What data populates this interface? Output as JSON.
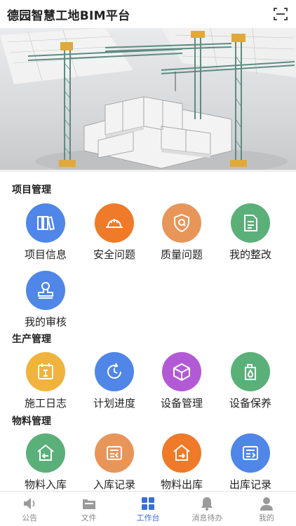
{
  "header": {
    "title": "德园智慧工地BIM平台",
    "scan_icon": "scan-icon"
  },
  "colors": {
    "accent": "#3a6ed6",
    "blue": "#4f86e8",
    "orange": "#ee7a2a",
    "light_orange": "#e8955a",
    "green": "#5bb07a",
    "yellow": "#f0b33e",
    "purple": "#b25ad6"
  },
  "sections": [
    {
      "title": "项目管理",
      "items": [
        {
          "label": "项目信息",
          "icon": "books-icon"
        },
        {
          "label": "安全问题",
          "icon": "hardhat-icon"
        },
        {
          "label": "质量问题",
          "icon": "shield-icon"
        },
        {
          "label": "我的整改",
          "icon": "document-icon"
        },
        {
          "label": "我的审核",
          "icon": "stamp-icon"
        }
      ]
    },
    {
      "title": "生产管理",
      "items": [
        {
          "label": "施工日志",
          "icon": "calendar-icon"
        },
        {
          "label": "计划进度",
          "icon": "clock-refresh-icon"
        },
        {
          "label": "设备管理",
          "icon": "box-icon"
        },
        {
          "label": "设备保养",
          "icon": "oil-can-icon"
        }
      ]
    },
    {
      "title": "物料管理",
      "items": [
        {
          "label": "物料入库",
          "icon": "warehouse-in-icon"
        },
        {
          "label": "入库记录",
          "icon": "record-in-icon"
        },
        {
          "label": "物料出库",
          "icon": "warehouse-out-icon"
        },
        {
          "label": "出库记录",
          "icon": "record-out-icon"
        }
      ]
    }
  ],
  "tabbar": [
    {
      "label": "公告",
      "icon": "speaker-icon",
      "active": false
    },
    {
      "label": "文件",
      "icon": "folder-icon",
      "active": false
    },
    {
      "label": "工作台",
      "icon": "grid-icon",
      "active": true
    },
    {
      "label": "消息待办",
      "icon": "bell-icon",
      "active": false
    },
    {
      "label": "我的",
      "icon": "user-icon",
      "active": false
    }
  ]
}
